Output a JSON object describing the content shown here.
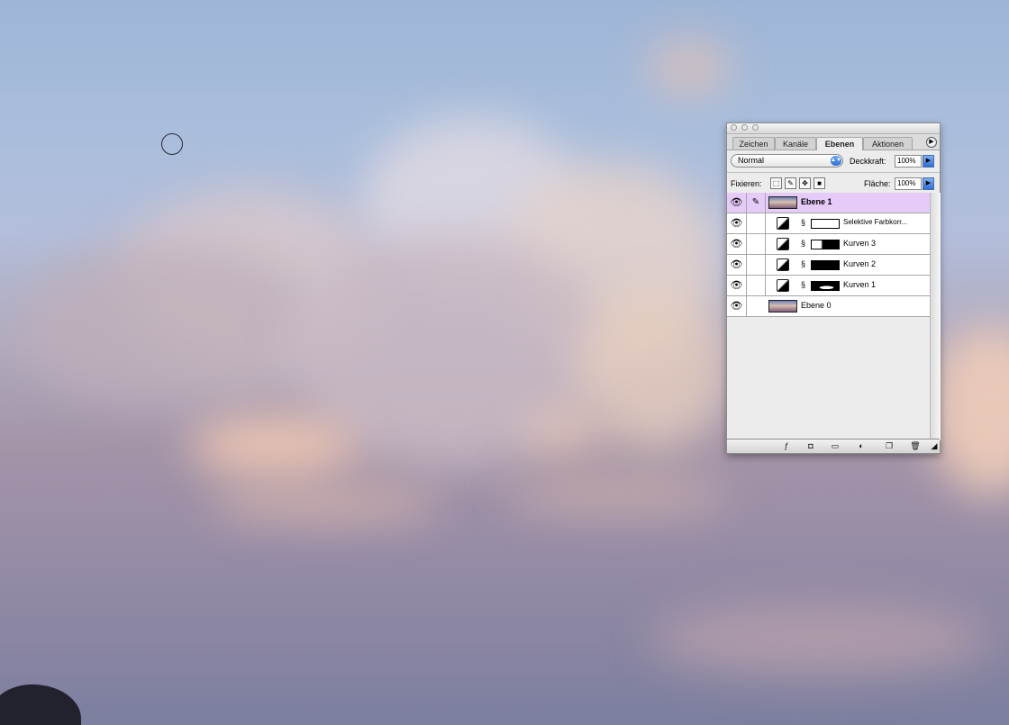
{
  "palette": {
    "tabs": [
      {
        "label": "Zeichen",
        "active": false
      },
      {
        "label": "Kanäle",
        "active": false
      },
      {
        "label": "Ebenen",
        "active": true
      },
      {
        "label": "Aktionen",
        "active": false
      }
    ],
    "blend_mode": "Normal",
    "opacity_label": "Deckkraft:",
    "opacity_value": "100%",
    "lock_label": "Fixieren:",
    "fill_label": "Fläche:",
    "fill_value": "100%",
    "layers": [
      {
        "name": "Ebene 1",
        "type": "pixel",
        "selected": true,
        "visible": true
      },
      {
        "name": "Selektive Farbkorr...",
        "type": "adjustment",
        "selected": false,
        "visible": true
      },
      {
        "name": "Kurven 3",
        "type": "adjustment",
        "selected": false,
        "visible": true
      },
      {
        "name": "Kurven 2",
        "type": "adjustment",
        "selected": false,
        "visible": true
      },
      {
        "name": "Kurven 1",
        "type": "adjustment",
        "selected": false,
        "visible": true
      },
      {
        "name": "Ebene 0",
        "type": "pixel",
        "selected": false,
        "visible": true
      }
    ]
  },
  "colors": {
    "selected_layer": "#e6cbf8",
    "accent_blue": "#2f6ed3"
  }
}
